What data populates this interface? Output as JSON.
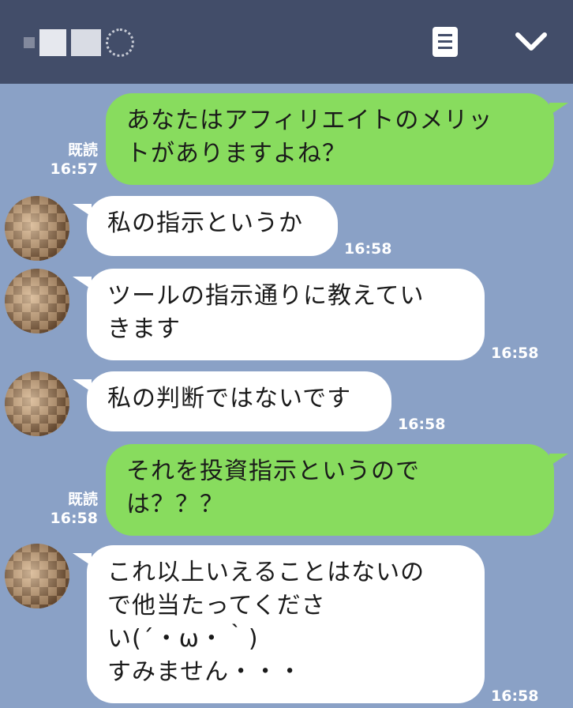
{
  "header": {
    "menu_icon": "note-icon",
    "collapse_icon": "chevron-down-icon",
    "background": "#424d69"
  },
  "colors": {
    "chat_background": "#8aa1c6",
    "sent_bubble": "#88dc5e",
    "received_bubble": "#ffffff"
  },
  "messages": [
    {
      "from": "me",
      "lines": [
        "あなたはアフィリエイトのメリッ",
        "トがありますよね？"
      ],
      "read": "既読",
      "time": "16:57"
    },
    {
      "from": "them",
      "lines": [
        "私の指示というか"
      ],
      "time": "16:58"
    },
    {
      "from": "them",
      "lines": [
        "ツールの指示通りに教えてい",
        "きます"
      ],
      "time": "16:58"
    },
    {
      "from": "them",
      "lines": [
        "私の判断ではないです"
      ],
      "time": "16:58"
    },
    {
      "from": "me",
      "lines": [
        "それを投資指示というので",
        "は？？？"
      ],
      "read": "既読",
      "time": "16:58"
    },
    {
      "from": "them",
      "lines": [
        "これ以上いえることはないの",
        "で他当たってくださ",
        "い(´・ω・｀)",
        "すみません・・・"
      ],
      "time": "16:58"
    }
  ]
}
